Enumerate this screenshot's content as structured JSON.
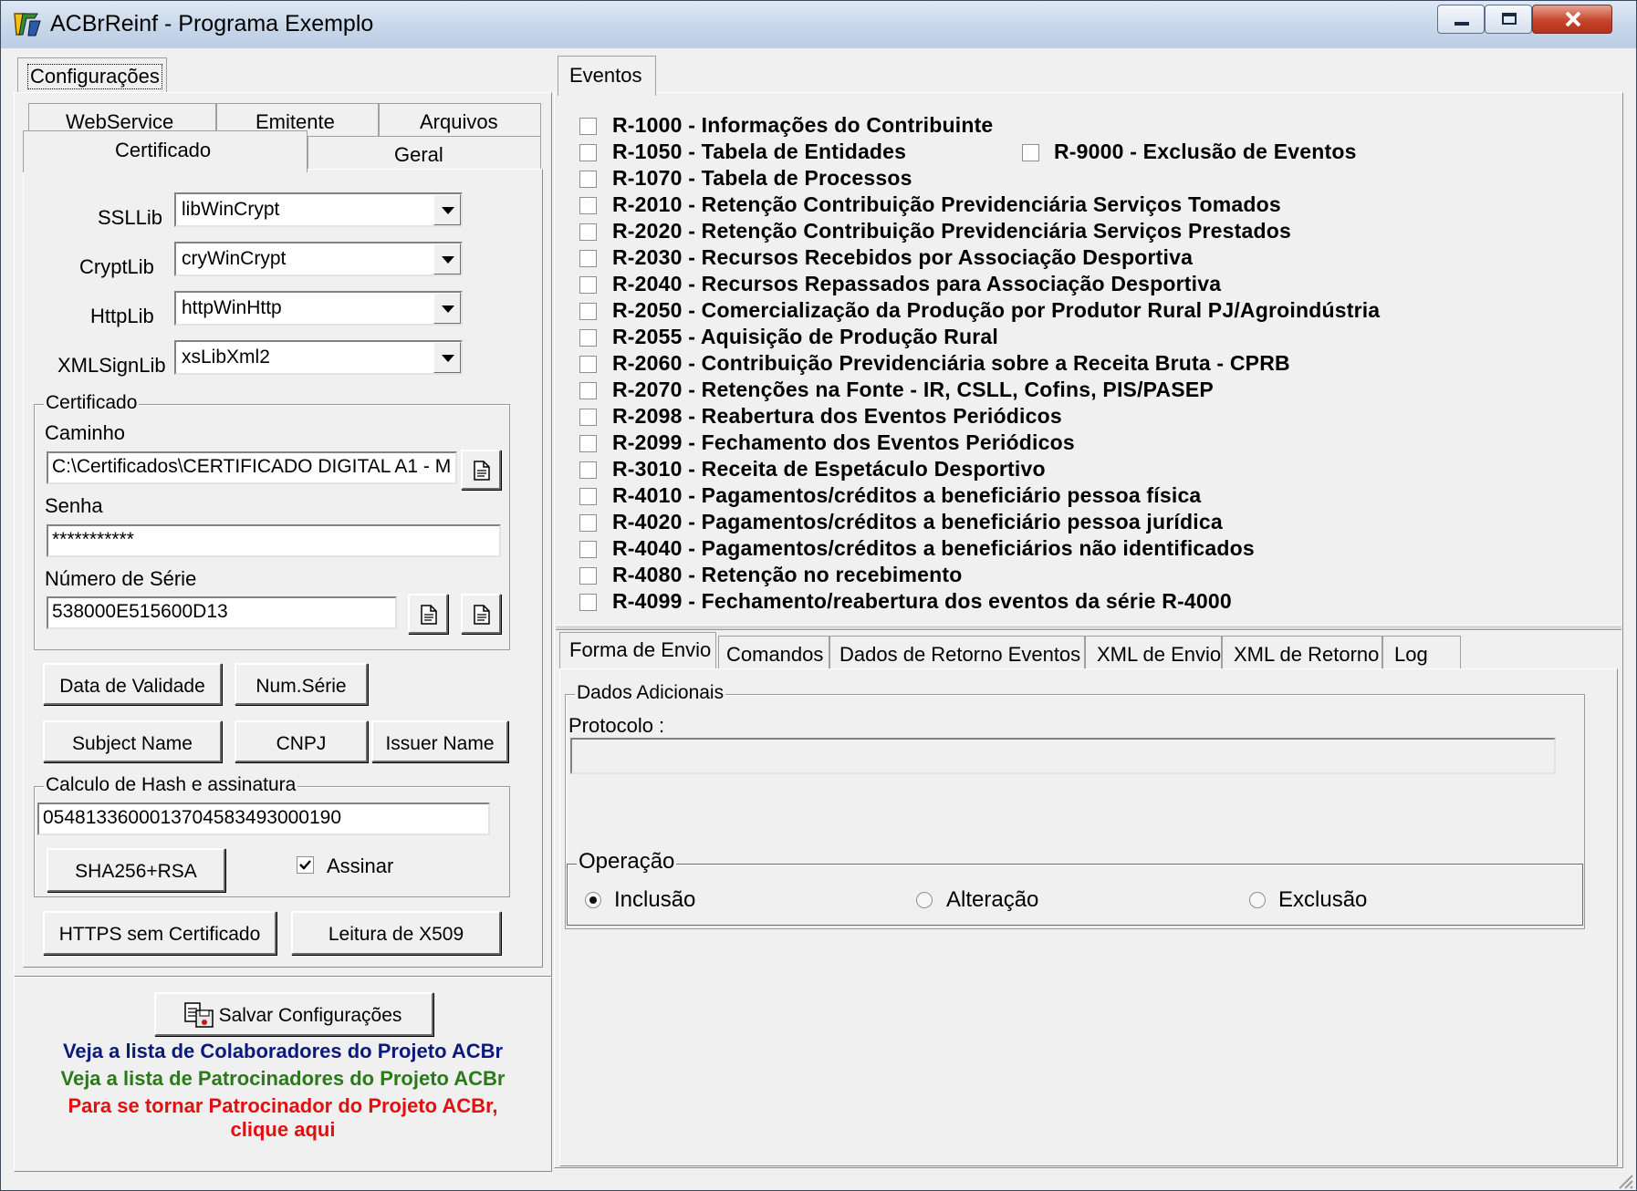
{
  "window": {
    "title": "ACBrReinf - Programa Exemplo"
  },
  "left": {
    "tab_config": "Configurações",
    "subtabs": [
      "WebService",
      "Emitente",
      "Arquivos",
      "Certificado",
      "Geral"
    ],
    "ssl": {
      "label": "SSLLib",
      "value": "libWinCrypt"
    },
    "crypt": {
      "label": "CryptLib",
      "value": "cryWinCrypt"
    },
    "http": {
      "label": "HttpLib",
      "value": "httpWinHttp"
    },
    "xmlsign": {
      "label": "XMLSignLib",
      "value": "xsLibXml2"
    },
    "cert": {
      "group_title": "Certificado",
      "caminho_label": "Caminho",
      "caminho_value": "C:\\Certificados\\CERTIFICADO DIGITAL A1 - M",
      "senha_label": "Senha",
      "senha_value": "***********",
      "serie_label": "Número de Série",
      "serie_value": "538000E515600D13"
    },
    "buttons": {
      "data_validade": "Data de Validade",
      "num_serie": "Num.Série",
      "subject_name": "Subject Name",
      "cnpj": "CNPJ",
      "issuer_name": "Issuer Name",
      "sha": "SHA256+RSA",
      "https": "HTTPS sem Certificado",
      "x509": "Leitura de X509",
      "salvar": "Salvar Configurações"
    },
    "hash": {
      "group_title": "Calculo de Hash e assinatura",
      "value": "05481336000137045834930001​90",
      "assinar_label": "Assinar",
      "assinar_checked": true
    },
    "links": {
      "colaboradores": "Veja a lista de Colaboradores do Projeto ACBr",
      "patrocinadores": "Veja a lista de Patrocinadores do Projeto ACBr",
      "tornar_line1": "Para se tornar Patrocinador do Projeto ACBr,",
      "tornar_line2": "clique aqui"
    },
    "colors": {
      "colaboradores": "#0a1a7a",
      "patrocinadores": "#2a7a1a",
      "tornar": "#e01010"
    }
  },
  "right": {
    "tab_eventos": "Eventos",
    "events": [
      "R-1000 - Informações do Contribuinte",
      "R-1050 - Tabela de Entidades",
      "R-1070 - Tabela de Processos",
      "R-2010 - Retenção Contribuição Previdenciária  Serviços Tomados",
      "R-2020 - Retenção Contribuição Previdenciária  Serviços Prestados",
      "R-2030 - Recursos Recebidos por Associação Desportiva",
      "R-2040 - Recursos Repassados para Associação Desportiva",
      "R-2050 - Comercialização da Produção por Produtor Rural PJ/Agroindústria",
      "R-2055 - Aquisição de Produção Rural",
      "R-2060 - Contribuição Previdenciária sobre a Receita Bruta - CPRB",
      "R-2070 - Retenções na Fonte - IR, CSLL, Cofins, PIS/PASEP",
      "R-2098 - Reabertura dos Eventos Periódicos",
      "R-2099 - Fechamento dos Eventos Periódicos",
      "R-3010 - Receita de Espetáculo Desportivo",
      "R-4010 - Pagamentos/créditos a beneficiário pessoa física",
      "R-4020 - Pagamentos/créditos a beneficiário pessoa jurídica",
      "R-4040 - Pagamentos/créditos a beneficiários não identificados",
      "R-4080 - Retenção no recebimento",
      "R-4099 - Fechamento/reabertura dos eventos da série R-4000"
    ],
    "event_9000": "R-9000 - Exclusão de Eventos",
    "bottom_tabs": [
      "Forma de Envio",
      "Comandos",
      "Dados de Retorno Eventos",
      "XML de Envio",
      "XML de Retorno",
      "Log"
    ],
    "dados": {
      "group_title": "Dados Adicionais",
      "protocolo_label": "Protocolo :",
      "protocolo_value": ""
    },
    "operacao": {
      "group_title": "Operação",
      "options": [
        "Inclusão",
        "Alteração",
        "Exclusão"
      ],
      "selected": "Inclusão"
    }
  }
}
